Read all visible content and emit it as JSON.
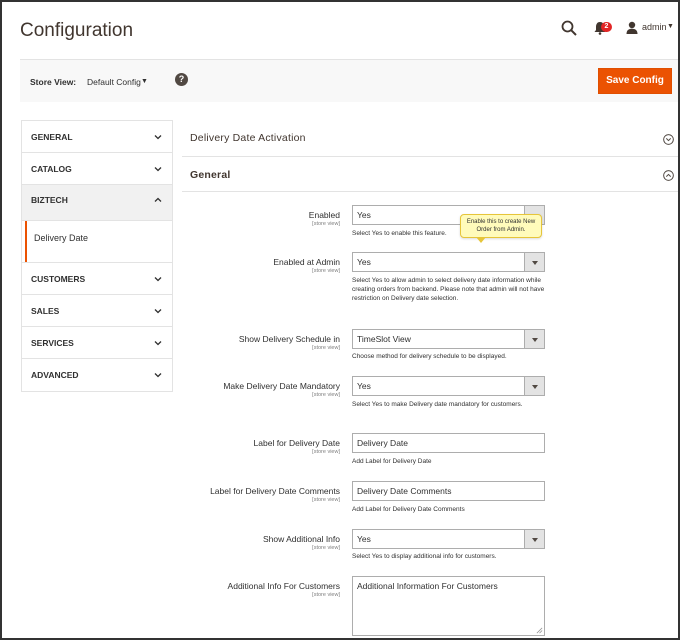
{
  "header": {
    "title": "Configuration",
    "notifications_count": "2",
    "user_name": "admin"
  },
  "toolbar": {
    "store_view_label": "Store View:",
    "store_view_value": "Default Config",
    "save_label": "Save Config"
  },
  "sidebar": {
    "items": [
      {
        "label": "GENERAL"
      },
      {
        "label": "CATALOG"
      },
      {
        "label": "BIZTECH"
      },
      {
        "label": "CUSTOMERS"
      },
      {
        "label": "SALES"
      },
      {
        "label": "SERVICES"
      },
      {
        "label": "ADVANCED"
      }
    ],
    "sub_item": "Delivery Date"
  },
  "main": {
    "section_activation": "Delivery Date Activation",
    "section_general": "General",
    "scope": "[store view]",
    "tooltip": "Enable this to create New Order from Admin.",
    "fields": [
      {
        "label": "Enabled",
        "value": "Yes",
        "note": "Select Yes to enable this feature."
      },
      {
        "label": "Enabled at Admin",
        "value": "Yes",
        "note": "Select Yes to allow admin to select delivery date information while creating orders from backend. Please note that admin will not have restriction on Delivery date selection."
      },
      {
        "label": "Show Delivery Schedule in",
        "value": "TimeSlot View",
        "note": "Choose method for delivery schedule to be displayed."
      },
      {
        "label": "Make Delivery Date Mandatory",
        "value": "Yes",
        "note": "Select Yes to make Delivery date mandatory for customers."
      },
      {
        "label": "Label for Delivery Date",
        "value": "Delivery Date",
        "note": "Add Label for Delivery Date"
      },
      {
        "label": "Label for Delivery Date Comments",
        "value": "Delivery Date Comments",
        "note": "Add Label for Delivery Date Comments"
      },
      {
        "label": "Show Additional Info",
        "value": "Yes",
        "note": "Select Yes to display additional info for customers."
      },
      {
        "label": "Additional Info For Customers",
        "value": "Additional Information For Customers"
      }
    ]
  },
  "colors": {
    "accent": "#eb5202",
    "badge": "#e22626",
    "tooltip_bg": "#fffbbb"
  }
}
